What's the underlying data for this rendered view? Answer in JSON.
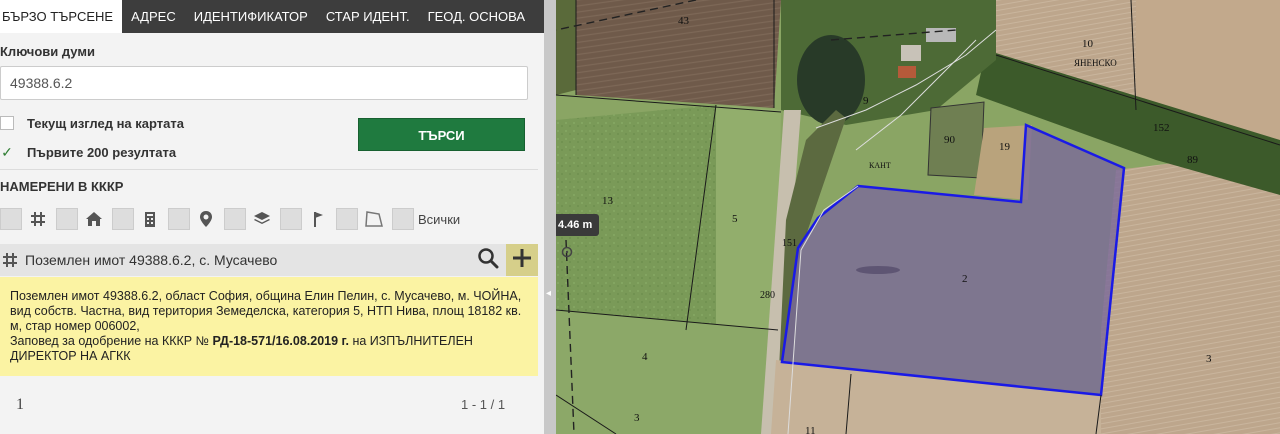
{
  "tabs": [
    {
      "label": "БЪРЗО ТЪРСЕНЕ"
    },
    {
      "label": "АДРЕС"
    },
    {
      "label": "ИДЕНТИФИКАТОР"
    },
    {
      "label": "СТАР ИДЕНТ."
    },
    {
      "label": "ГЕОД. ОСНОВА"
    }
  ],
  "search": {
    "keywords_label": "Ключови думи",
    "keywords_value": "49388.6.2",
    "current_view_label": "Текущ изглед на картата",
    "first_200_label": "Първите 200 резултата",
    "first_200_check": "✓",
    "button_label": "ТЪРСИ"
  },
  "found": {
    "label": "НАМЕРЕНИ В КККР",
    "all_label": "Всички"
  },
  "result": {
    "title": "Поземлен имот 49388.6.2, с. Мусачево",
    "info_line1": "Поземлен имот 49388.6.2, област София, община Елин Пелин, с. Мусачево, м. ЧОЙНА, вид собств. Частна, вид територия Земеделска, категория 5, НТП Нива, площ 18182 кв. м, стар номер 006002,",
    "info_order_prefix": "Заповед за одобрение на КККР № ",
    "info_order_number": "РД-18-571/16.08.2019 г.",
    "info_order_suffix": " на ИЗПЪЛНИТЕЛЕН ДИРЕКТОР НА АГКК"
  },
  "pager": {
    "page": "1",
    "range": "1 - 1 / 1"
  },
  "map": {
    "measure_label": "4.46 m",
    "parcel_labels": {
      "p43": "43",
      "p10": "10",
      "locality": "ЯНЕНСКО",
      "p9": "9",
      "p90": "90",
      "p19": "19",
      "p152": "152",
      "p89": "89",
      "p13": "13",
      "p5": "5",
      "kant": "КАНТ",
      "p151": "151",
      "p2": "2",
      "p280": "280",
      "p4": "4",
      "p3a": "3",
      "p3b": "3",
      "p11": "11"
    },
    "colors": {
      "selected_outline": "#1a1ae6",
      "selected_fill": "#7a6a9a"
    }
  }
}
